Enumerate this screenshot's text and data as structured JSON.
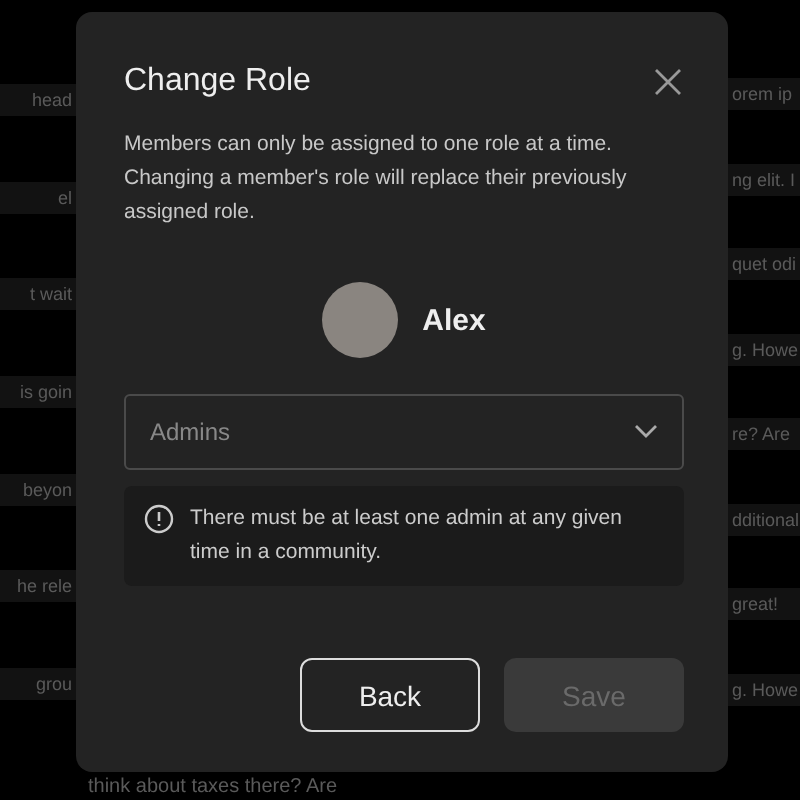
{
  "background": {
    "left_fragments": [
      "head",
      "el",
      "t wait",
      "is goin",
      "beyon",
      "he rele",
      "grou"
    ],
    "right_fragments": [
      "orem ip",
      "ng elit. I",
      "quet odi",
      "g. Howe",
      "re? Are",
      "dditional",
      "great!",
      "g. Howe"
    ],
    "bottom_fragment": "think about taxes there? Are"
  },
  "dialog": {
    "title": "Change Role",
    "description": "Members can only be assigned to one role at a time. Changing a member's role will replace their previously assigned role.",
    "member": {
      "name": "Alex"
    },
    "role_select": {
      "value": "Admins"
    },
    "notice": "There must be at least one admin at any given time in a community.",
    "buttons": [
      {
        "label": "Back",
        "kind": "secondary",
        "disabled": false
      },
      {
        "label": "Save",
        "kind": "primary",
        "disabled": true
      }
    ]
  }
}
